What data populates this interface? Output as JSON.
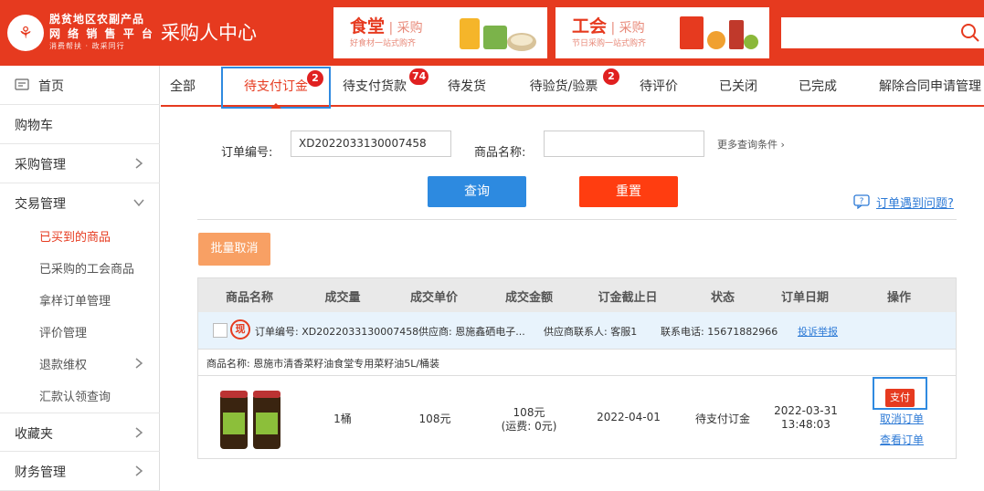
{
  "header": {
    "logo_line1": "脱贫地区农副产品",
    "logo_line2": "网 络 销 售 平 台",
    "logo_line3": "消费帮扶 · 政采同行",
    "title": "采购人中心",
    "banner1": {
      "title": "食堂",
      "sub": "采购",
      "desc": "好食材一站式购齐"
    },
    "banner2": {
      "title": "工会",
      "sub": "采购",
      "desc": "节日采购一站式购齐"
    },
    "search_placeholder": ""
  },
  "sidebar": {
    "home": "首页",
    "cart": "购物车",
    "purchase_mgmt": "采购管理",
    "trade_mgmt": "交易管理",
    "sub_items": [
      "已买到的商品",
      "已采购的工会商品",
      "拿样订单管理",
      "评价管理",
      "退款维权",
      "汇款认领查询"
    ],
    "favorites": "收藏夹",
    "finance": "财务管理"
  },
  "tabs": [
    {
      "label": "全部"
    },
    {
      "label": "待支付订金",
      "badge": "2"
    },
    {
      "label": "待支付货款",
      "badge": "74"
    },
    {
      "label": "待发货"
    },
    {
      "label": "待验货/验票",
      "badge": "2"
    },
    {
      "label": "待评价"
    },
    {
      "label": "已关闭"
    },
    {
      "label": "已完成"
    },
    {
      "label": "解除合同申请管理"
    }
  ],
  "filter": {
    "order_no_label": "订单编号:",
    "order_no_value": "XD2022033130007458",
    "product_label": "商品名称:",
    "product_value": "",
    "more": "更多查询条件 ›",
    "query": "查询",
    "reset": "重置",
    "help": "订单遇到问题?",
    "batch_cancel": "批量取消"
  },
  "table": {
    "headers": [
      "商品名称",
      "成交量",
      "成交单价",
      "成交金额",
      "订金截止日",
      "状态",
      "订单日期",
      "操作"
    ],
    "order": {
      "badge": "现",
      "order_no": "订单编号: XD2022033130007458",
      "supplier": "供应商: 恩施鑫硒电子...",
      "contact": "供应商联系人: 客服1",
      "phone": "联系电话: 15671882966",
      "report": "投诉举报"
    },
    "product_name": "商品名称: 恩施市清香菜籽油食堂专用菜籽油5L/桶装",
    "row": {
      "qty": "1桶",
      "unit_price": "108元",
      "amount": "108元",
      "shipping": "(运费: 0元)",
      "deadline": "2022-04-01",
      "status": "待支付订金",
      "date": "2022-03-31",
      "time": "13:48:03",
      "pay": "支付",
      "cancel": "取消订单",
      "view": "查看订单"
    }
  }
}
